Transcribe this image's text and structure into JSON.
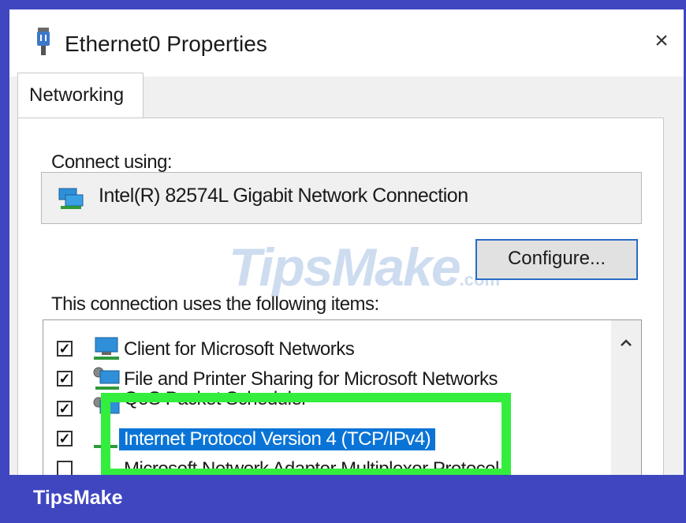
{
  "window": {
    "title": "Ethernet0 Properties",
    "close_symbol": "×"
  },
  "tabs": [
    {
      "label": "Networking",
      "active": true
    }
  ],
  "connect": {
    "label": "Connect using:",
    "adapter_name": "Intel(R) 82574L Gigabit Network Connection",
    "adapter_icon": "network-adapter-icon",
    "configure_label": "Configure..."
  },
  "items_section": {
    "label": "This connection uses the following items:",
    "items": [
      {
        "label": "Client for Microsoft Networks",
        "checked": true,
        "check_symbol": "✓",
        "icon": "network-client-icon"
      },
      {
        "label": "File and Printer Sharing for Microsoft Networks",
        "checked": true,
        "check_symbol": "✓",
        "icon": "file-printer-sharing-icon"
      },
      {
        "label": "QoS Packet Scheduler",
        "checked": true,
        "check_symbol": "✓",
        "icon": "qos-icon"
      },
      {
        "label": "Internet Protocol Version 4 (TCP/IPv4)",
        "checked": true,
        "check_symbol": "✓",
        "selected": true,
        "icon": "protocol-icon"
      },
      {
        "label": "Microsoft Network Adapter Multiplexor Protocol",
        "checked": false,
        "check_symbol": "",
        "icon": "protocol-icon"
      }
    ]
  },
  "watermark": {
    "brand": "TipsMake",
    "suffix": ".com"
  },
  "footer": {
    "brand": "TipsMake"
  },
  "colors": {
    "accent": "#3f46c0",
    "highlight": "#34ee3d",
    "selection": "#0a74d6",
    "focus_border": "#2a6ac4"
  }
}
